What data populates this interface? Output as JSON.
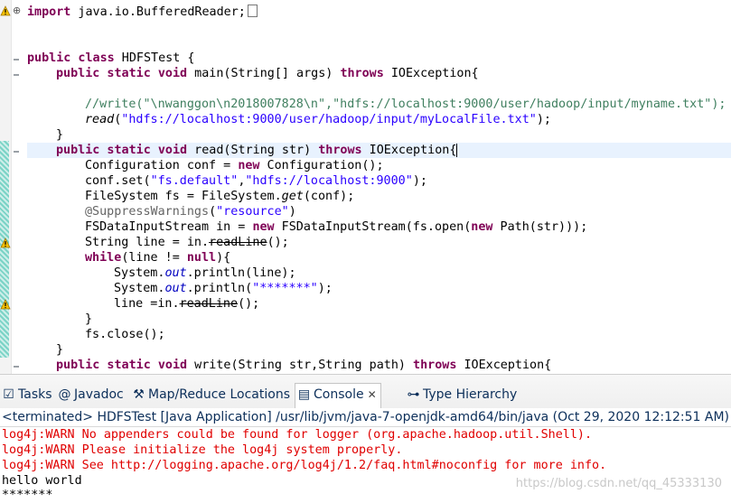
{
  "editor": {
    "import_kw": "import",
    "import_rest": " java.io.BufferedReader;",
    "class_line": {
      "kw": "public class",
      "rest": " HDFSTest {"
    },
    "main_line": {
      "kw": "public static void",
      "rest": " main(String[] args) ",
      "throws": "throws",
      "exc": " IOException{"
    },
    "comment_line": "//write(\"\\nwanggon\\n2018007828\\n\",\"hdfs://localhost:9000/user/hadoop/input/myname.txt\");",
    "read_call": {
      "fn": "read",
      "open": "(",
      "str": "\"hdfs://localhost:9000/user/hadoop/input/myLocalFile.txt\"",
      "close": ");"
    },
    "close_brace_1": "}",
    "read_decl": {
      "kw": "public static void",
      "rest": " read(String str) ",
      "throws": "throws",
      "exc": " IOException{"
    },
    "conf_line": {
      "a": "Configuration conf = ",
      "kw": "new",
      "b": " Configuration();"
    },
    "confset_line": {
      "a": "conf.set(",
      "s1": "\"fs.default\"",
      "c": ",",
      "s2": "\"hdfs://localhost:9000\"",
      "b": ");"
    },
    "fs_line": {
      "a": "FileSystem fs = FileSystem.",
      "m": "get",
      "b": "(conf);"
    },
    "suppress_line": {
      "ann": "@SuppressWarnings",
      "a": "(",
      "s": "\"resource\"",
      "b": ")"
    },
    "fsin_line": {
      "a": "FSDataInputStream in = ",
      "kw1": "new",
      "b": " FSDataInputStream(fs.open(",
      "kw2": "new",
      "c": " Path(str)));"
    },
    "strline_line": {
      "a": "String line = in.",
      "dep": "readLine",
      "b": "();"
    },
    "while_line": {
      "kw": "while",
      "a": "(line != ",
      "kw2": "null",
      "b": "){"
    },
    "println1": {
      "a": "System.",
      "f": "out",
      "b": ".println(line);"
    },
    "println2": {
      "a": "System.",
      "f": "out",
      "b": ".println(",
      "s": "\"*******\"",
      "c": ");"
    },
    "lineassign": {
      "a": "line =in.",
      "dep": "readLine",
      "b": "();"
    },
    "close_brace_2": "}",
    "fsclose": "fs.close();",
    "close_brace_3": "}",
    "write_decl": {
      "kw": "public static void",
      "rest": " write(String str,String path) ",
      "throws": "throws",
      "exc": " IOException{"
    }
  },
  "tabs": [
    {
      "label": "Tasks",
      "icon": "☑"
    },
    {
      "label": "Javadoc",
      "icon": "@"
    },
    {
      "label": "Map/Reduce Locations",
      "icon": "⚒"
    },
    {
      "label": "Console",
      "icon": "▤",
      "close": "✕"
    },
    {
      "label": "Type Hierarchy",
      "icon": "⊶"
    }
  ],
  "console": {
    "status": "<terminated> HDFSTest [Java Application] /usr/lib/jvm/java-7-openjdk-amd64/bin/java (Oct 29, 2020 12:12:51 AM)",
    "lines": [
      "log4j:WARN No appenders could be found for logger (org.apache.hadoop.util.Shell).",
      "log4j:WARN Please initialize the log4j system properly.",
      "log4j:WARN See http://logging.apache.org/log4j/1.2/faq.html#noconfig for more info.",
      "hello world",
      "*******"
    ]
  },
  "watermark": "https://blog.csdn.net/qq_45333130",
  "colors": {
    "keyword": "#7f0055",
    "string": "#2a00ff",
    "comment": "#3f7f5f",
    "error": "#e00000",
    "field": "#0000c0"
  }
}
